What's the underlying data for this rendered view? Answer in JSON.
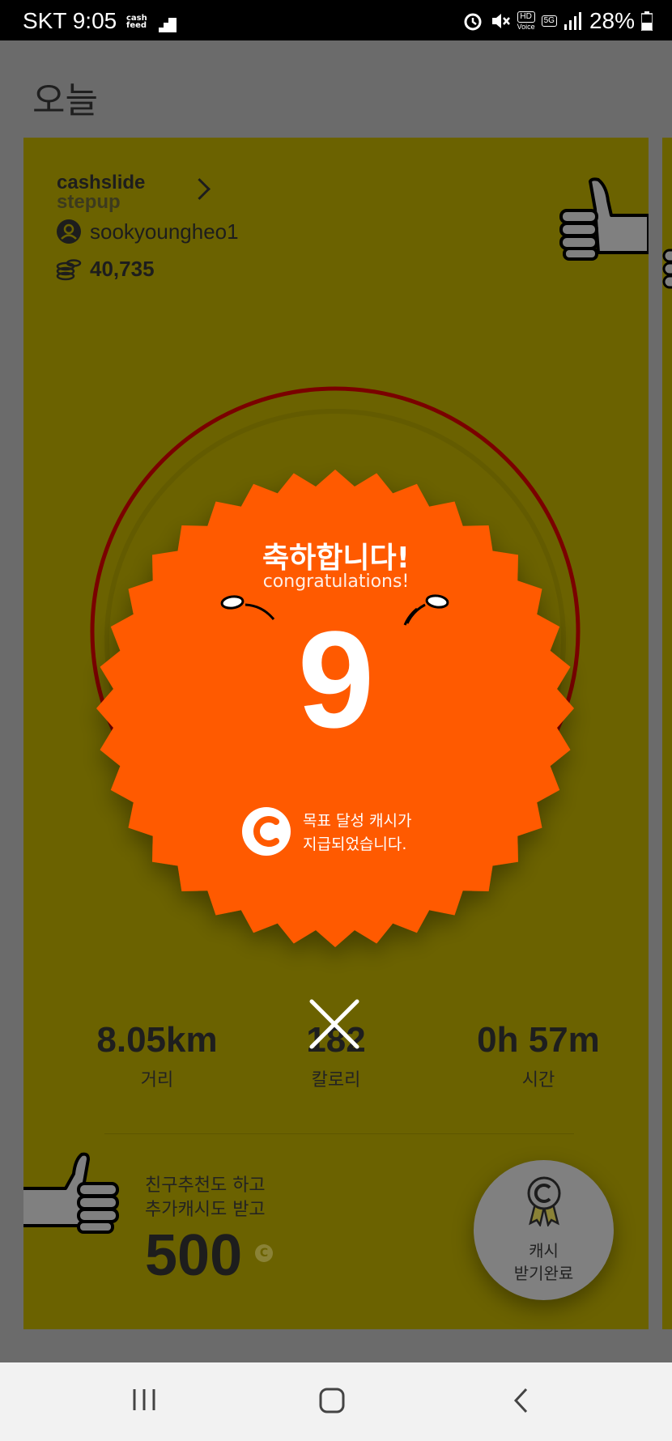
{
  "status_bar": {
    "carrier_time": "SKT 9:05",
    "cashfeed_top": "cash",
    "cashfeed_bottom": "feed",
    "hd": "HD",
    "voice": "Voice",
    "five_g": "5G",
    "battery": "28%"
  },
  "page": {
    "title": "오늘"
  },
  "card": {
    "brand_top": "cashslide",
    "brand_bottom": "stepup",
    "username": "sookyoungheo1",
    "coins": "40,735"
  },
  "celebration": {
    "title": "축하합니다!",
    "subtitle": "congratulations!",
    "number": "9",
    "coin_glyph": "C",
    "message_line1": "목표 달성 캐시가",
    "message_line2": "지급되었습니다."
  },
  "stats": [
    {
      "value": "8.05km",
      "label": "거리"
    },
    {
      "value": "182",
      "label": "칼로리"
    },
    {
      "value": "0h 57m",
      "label": "시간"
    }
  ],
  "promo": {
    "line1": "친구추천도 하고",
    "line2": "추가캐시도 받고",
    "amount": "500",
    "coin": "C"
  },
  "cash_button": {
    "line1": "캐시",
    "line2": "받기완료"
  },
  "colors": {
    "card": "#6b6200",
    "badge": "#ff5a00",
    "ring": "#7a0000",
    "overlay": "#6b6b6b"
  }
}
